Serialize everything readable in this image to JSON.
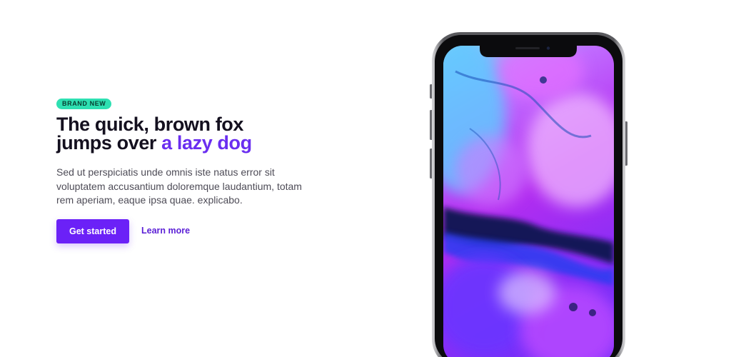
{
  "hero": {
    "badge": "BRAND NEW",
    "headline_line1": "The quick, brown fox",
    "headline_line2_prefix": "jumps over ",
    "headline_highlight": "a lazy dog",
    "body": "Sed ut perspiciatis unde omnis iste natus error sit voluptatem accusantium doloremque laudantium, totam rem aperiam, eaque ipsa quae. explicabo.",
    "primary_cta": "Get started",
    "secondary_cta": "Learn more"
  },
  "colors": {
    "accent": "#6b21f7",
    "highlight": "#6a2ef0",
    "badge_bg": "#2ee0b2",
    "text_dark": "#14101f",
    "text_muted": "#4e4c57"
  },
  "device": {
    "model": "smartphone",
    "wallpaper": "abstract purple and blue ink"
  }
}
